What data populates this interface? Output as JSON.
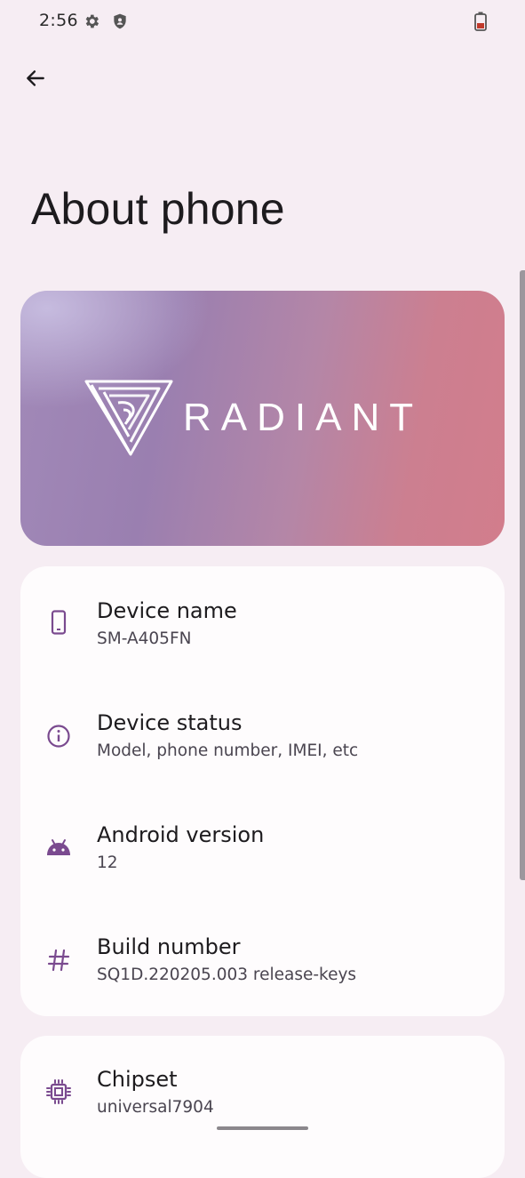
{
  "status_bar": {
    "time": "2:56",
    "icons": [
      "gear-icon",
      "shield-icon",
      "battery-icon"
    ],
    "battery_color": "#c0392b"
  },
  "header": {
    "back_icon": "arrow-left-icon",
    "title": "About phone"
  },
  "banner": {
    "brand": "RADIANT",
    "logo_icon": "radiant-logo"
  },
  "device_info": [
    {
      "icon": "phone-icon",
      "title": "Device name",
      "subtitle": "SM-A405FN"
    },
    {
      "icon": "info-icon",
      "title": "Device status",
      "subtitle": "Model, phone number, IMEI, etc"
    },
    {
      "icon": "android-icon",
      "title": "Android version",
      "subtitle": "12"
    },
    {
      "icon": "hash-icon",
      "title": "Build number",
      "subtitle": "SQ1D.220205.003 release-keys"
    }
  ],
  "hardware_info": [
    {
      "icon": "chip-icon",
      "title": "Chipset",
      "subtitle": "universal7904"
    }
  ],
  "colors": {
    "background": "#f6edf3",
    "card": "#fefcfd",
    "accent": "#7a4a8f"
  }
}
